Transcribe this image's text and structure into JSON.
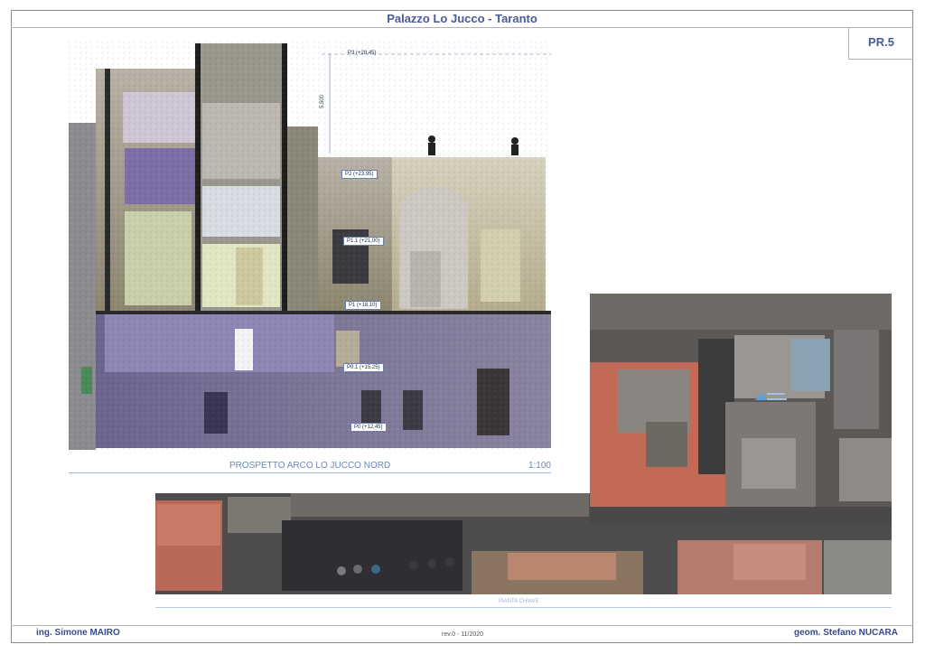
{
  "sheet": {
    "title": "Palazzo Lo Jucco - Taranto",
    "code": "PR.5"
  },
  "elevation": {
    "caption": "PROSPETTO ARCO LO JUCCO NORD",
    "scale": "1:100",
    "dimension": "5,500",
    "levels": {
      "p3": "P3 (+28,45)",
      "p2": "P2 (+23,95)",
      "p11": "P1.1 (+21,00)",
      "p1": "P1 (+18,10)",
      "p01": "P0.1 (+15,25)",
      "p0": "P0 (+12,45)"
    }
  },
  "map": {
    "caption": "PIANTA CHIAVE"
  },
  "footer": {
    "left": "ing. Simone MAIRO",
    "center": "rev.0 - 11/2020",
    "right": "geom. Stefano NUCARA"
  }
}
